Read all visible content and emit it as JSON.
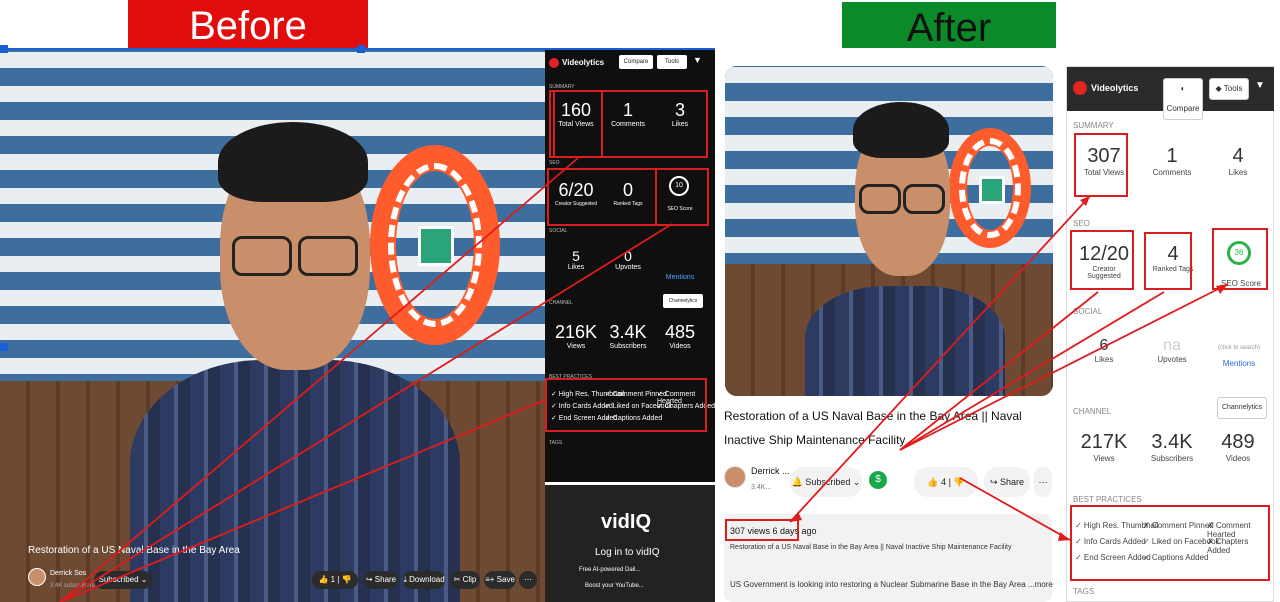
{
  "banners": {
    "before": "Before",
    "after": "After",
    "before_color": "#e10d0d",
    "after_color": "#0b8a2a"
  },
  "before": {
    "video_title": "Restoration of a US Naval Base in the Bay Area",
    "channel_name": "Derrick Sos",
    "channel_subs": "3.4K subscribers",
    "subscribed_label": "Subscribed",
    "controls": {
      "likes": "1",
      "share": "Share",
      "download": "Download",
      "clip": "Clip",
      "save": "Save"
    },
    "panel": {
      "brand": "Videolytics",
      "compare": "Compare",
      "tools": "Tools",
      "summary_label": "SUMMARY",
      "summary": [
        {
          "value": "160",
          "label": "Total Views"
        },
        {
          "value": "1",
          "label": "Comments"
        },
        {
          "value": "3",
          "label": "Likes"
        }
      ],
      "seo_label": "SEO",
      "seo": [
        {
          "value": "6/20",
          "label": "Creator Suggested"
        },
        {
          "value": "0",
          "label": "Ranked Tags"
        },
        {
          "value": "10",
          "label": "SEO Score"
        }
      ],
      "social_label": "SOCIAL",
      "social": [
        {
          "value": "5",
          "label": "Likes"
        },
        {
          "value": "0",
          "label": "Upvotes"
        },
        {
          "value": "",
          "label": "Mentions"
        }
      ],
      "channel_label": "CHANNEL",
      "channelytics": "Channelytics",
      "channel": [
        {
          "value": "216K",
          "label": "Views"
        },
        {
          "value": "3.4K",
          "label": "Subscribers"
        },
        {
          "value": "485",
          "label": "Videos"
        }
      ],
      "bp_label": "BEST PRACTICES",
      "bp": [
        "✓ High Res. Thumbnail",
        "✓ Comment Pinned",
        "✓ Comment Hearted",
        "✓ Info Cards Added",
        "✓ Liked on Facebook",
        "✓ Chapters Added",
        "✓ End Screen Added",
        "✓ Captions Added"
      ],
      "tags_label": "TAGS"
    },
    "vidiq": {
      "logo": "vidIQ",
      "login": "Log in to vidIQ",
      "line1": "Free AI-powered Dail...",
      "line2": "Boost your YouTube..."
    }
  },
  "after": {
    "video_title": "Restoration of a US Naval Base in the Bay Area || Naval Inactive Ship Maintenance Facility",
    "channel_name": "Derrick ...",
    "channel_subs": "3.4K...",
    "subscribed_label": "Subscribed",
    "likes": "4",
    "share": "Share",
    "meta": "307 views  6 days ago",
    "desc1": "Restoration of a US Naval Base in the Bay Area || Naval Inactive Ship Maintenance Facility",
    "desc2": "US Government is looking into restoring a Nuclear Submarine Base in the Bay Area ...more",
    "panel": {
      "brand": "Videolytics",
      "compare": "Compare",
      "tools": "Tools",
      "summary_label": "SUMMARY",
      "summary": [
        {
          "value": "307",
          "label": "Total Views"
        },
        {
          "value": "1",
          "label": "Comments"
        },
        {
          "value": "4",
          "label": "Likes"
        }
      ],
      "seo_label": "SEO",
      "seo": [
        {
          "value": "12/20",
          "label": "Creator Suggested"
        },
        {
          "value": "4",
          "label": "Ranked Tags"
        },
        {
          "value": "36",
          "label": "SEO Score"
        }
      ],
      "social_label": "SOCIAL",
      "social": [
        {
          "value": "6",
          "label": "Likes"
        },
        {
          "value": "na",
          "label": "Upvotes"
        },
        {
          "value": "(click to search)",
          "label": "Mentions"
        }
      ],
      "channel_label": "CHANNEL",
      "channelytics": "Channelytics",
      "channel": [
        {
          "value": "217K",
          "label": "Views"
        },
        {
          "value": "3.4K",
          "label": "Subscribers"
        },
        {
          "value": "489",
          "label": "Videos"
        }
      ],
      "bp_label": "BEST PRACTICES",
      "bp": [
        "✓ High Res. Thumbnail",
        "✗ Comment Pinned",
        "✗ Comment Hearted",
        "✓ Info Cards Added",
        "✓ Liked on Facebook",
        "✗ Chapters Added",
        "✓ End Screen Added",
        "✓ Captions Added"
      ],
      "tags_label": "TAGS"
    }
  }
}
